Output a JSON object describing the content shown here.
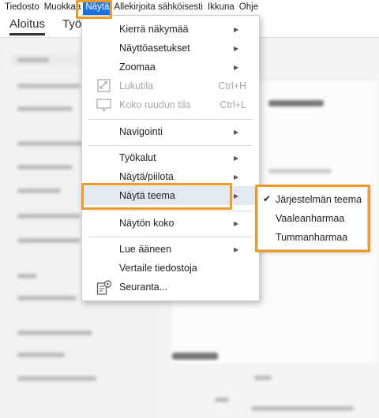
{
  "menubar": {
    "items": [
      "Tiedosto",
      "Muokkaa",
      "Näytä",
      "Allekirjoita sähköisesti",
      "Ikkuna",
      "Ohje"
    ]
  },
  "tabs": [
    "Aloitus",
    "Työ"
  ],
  "view_menu": {
    "items": [
      {
        "label": "Kierrä näkymää",
        "submenu": true
      },
      {
        "label": "Näyttöasetukset",
        "submenu": true
      },
      {
        "label": "Zoomaa",
        "submenu": true
      },
      {
        "label": "Lukutila",
        "shortcut": "Ctrl+H",
        "disabled": true,
        "icon": "reading-mode-icon"
      },
      {
        "label": "Koko ruudun tila",
        "shortcut": "Ctrl+L",
        "disabled": true,
        "icon": "full-screen-icon"
      },
      {
        "label": "Navigointi",
        "submenu": true
      },
      {
        "label": "Työkalut",
        "submenu": true
      },
      {
        "label": "Näytä/piilota",
        "submenu": true
      },
      {
        "label": "Näytä teema",
        "submenu": true,
        "highlighted": true
      },
      {
        "label": "Näytön koko",
        "submenu": true
      },
      {
        "label": "Lue ääneen",
        "submenu": true
      },
      {
        "label": "Vertaile tiedostoja"
      },
      {
        "label": "Seuranta...",
        "icon": "tracker-icon"
      }
    ]
  },
  "theme_submenu": {
    "items": [
      {
        "label": "Järjestelmän teema",
        "checked": true
      },
      {
        "label": "Vaaleanharmaa",
        "checked": false
      },
      {
        "label": "Tummanharmaa",
        "checked": false
      }
    ]
  },
  "colors": {
    "accent": "#1a73e8",
    "highlight": "#f09a2c",
    "hover": "#e3e9f3"
  }
}
